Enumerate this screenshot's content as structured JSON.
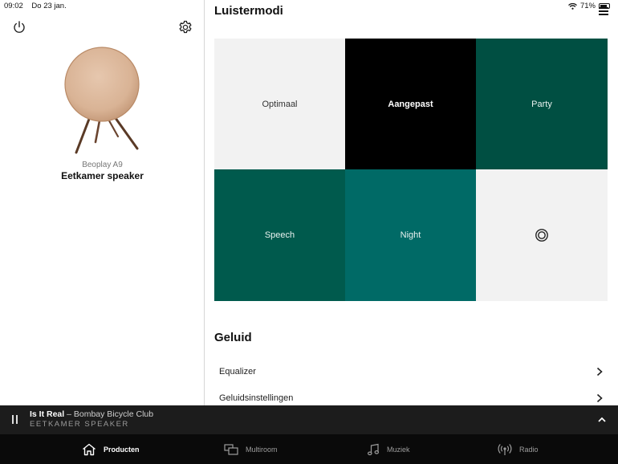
{
  "status": {
    "time": "09:02",
    "date": "Do 23 jan.",
    "battery": "71%"
  },
  "product": {
    "model": "Beoplay A9",
    "name": "Eetkamer speaker"
  },
  "listening_modes": {
    "title": "Luistermodi",
    "tiles": [
      {
        "label": "Optimaal"
      },
      {
        "label": "Aangepast"
      },
      {
        "label": "Party"
      },
      {
        "label": "Speech"
      },
      {
        "label": "Night"
      },
      {
        "label": ""
      }
    ]
  },
  "sound": {
    "title": "Geluid",
    "items": [
      {
        "label": "Equalizer"
      },
      {
        "label": "Geluidsinstellingen"
      }
    ]
  },
  "now_playing": {
    "title": "Is It Real",
    "separator": " – ",
    "artist": "Bombay Bicycle Club",
    "speaker": "EETKAMER SPEAKER"
  },
  "tabs": [
    {
      "label": "Producten",
      "icon": "home-icon"
    },
    {
      "label": "Multiroom",
      "icon": "multiroom-icon"
    },
    {
      "label": "Muziek",
      "icon": "music-note-icon"
    },
    {
      "label": "Radio",
      "icon": "radio-icon"
    }
  ],
  "colors": {
    "tile_light": "#f2f2f2",
    "tile_selected": "#000000",
    "tile_green_dark": "#004f42",
    "tile_green_mid": "#005a4d",
    "tile_teal": "#006a66",
    "player_bar": "#1c1c1c",
    "tab_bar": "#0a0a0a"
  }
}
